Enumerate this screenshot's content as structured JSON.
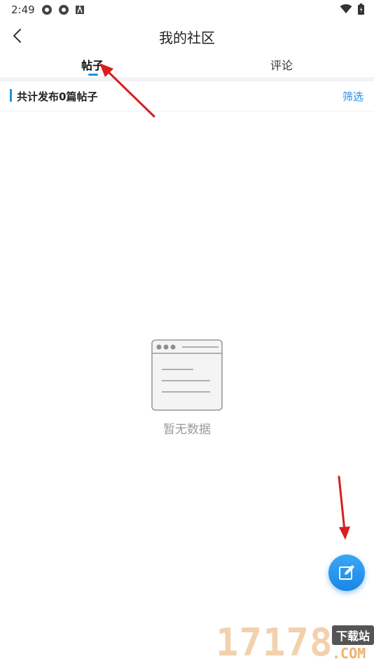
{
  "status_bar": {
    "time": "2:49"
  },
  "app_bar": {
    "title": "我的社区",
    "back_icon": "back-arrow-icon"
  },
  "tabs": [
    {
      "label": "帖子",
      "active": true
    },
    {
      "label": "评论",
      "active": false
    }
  ],
  "summary": {
    "text": "共计发布0篇帖子",
    "filter_label": "筛选"
  },
  "empty_state": {
    "text": "暂无数据",
    "icon": "empty-document-icon"
  },
  "fab": {
    "icon": "edit-icon"
  },
  "watermark": {
    "digits": "17178",
    "badge": "下载站",
    "domain": ".COM"
  },
  "colors": {
    "accent": "#1e90e8",
    "annotation_arrow": "#d81e1e",
    "empty_text": "#9a9a9a"
  }
}
